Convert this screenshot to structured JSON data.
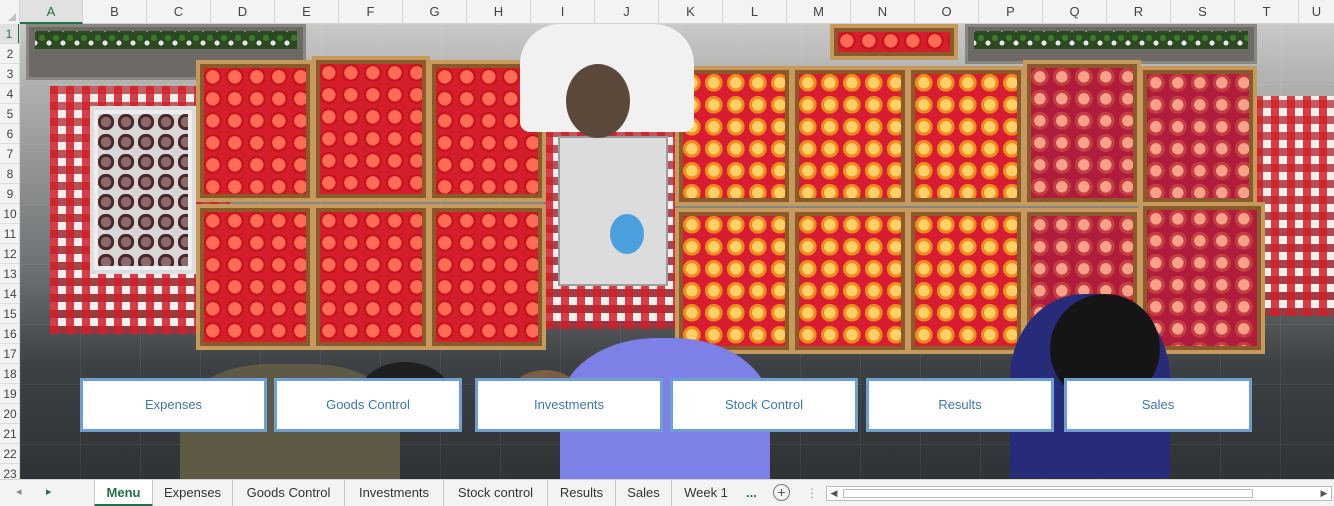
{
  "columns": [
    "A",
    "B",
    "C",
    "D",
    "E",
    "F",
    "G",
    "H",
    "I",
    "J",
    "K",
    "L",
    "M",
    "N",
    "O",
    "P",
    "Q",
    "R",
    "S",
    "T",
    "U"
  ],
  "rows": [
    "1",
    "2",
    "3",
    "4",
    "5",
    "6",
    "7",
    "8",
    "9",
    "10",
    "11",
    "12",
    "13",
    "14",
    "15",
    "16",
    "17",
    "18",
    "19",
    "20",
    "21",
    "22",
    "23"
  ],
  "selected_cell": {
    "column": "A",
    "row": "1"
  },
  "nav_buttons": [
    "Expenses",
    "Goods Control",
    "Investments",
    "Stock Control",
    "Results",
    "Sales"
  ],
  "sheet_tabs": [
    "Menu",
    "Expenses",
    "Goods Control",
    "Investments",
    "Stock control",
    "Results",
    "Sales",
    "Week 1"
  ],
  "active_tab": "Menu",
  "tab_controls": {
    "prev": "◂",
    "next": "▸",
    "more": "...",
    "add": "+",
    "separator": "⋮",
    "scroll_left": "◀",
    "scroll_right": "▶"
  },
  "colors": {
    "accent": "#217346",
    "button_border": "#6d9fd2",
    "button_text": "#3a77b8"
  }
}
